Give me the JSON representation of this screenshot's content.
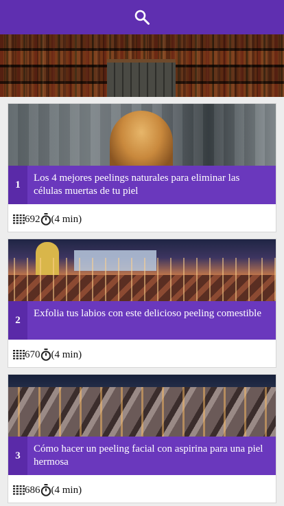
{
  "header": {
    "search_icon": "search-icon",
    "color": "#5f2fb0"
  },
  "banner": {
    "image": "bookshelf-library-photo"
  },
  "articles": [
    {
      "number": "1",
      "title": "Los 4 mejores peelings naturales para eliminar las células muertas de tu piel",
      "words": "692",
      "read_time": "(4 min)",
      "image": "woman-blonde-hair-blurred-street-photo"
    },
    {
      "number": "2",
      "title": "Exfolia tus labios con este delicioso peeling comestible",
      "words": "670",
      "read_time": "(4 min)",
      "image": "city-night-lights-photo"
    },
    {
      "number": "3",
      "title": "Cómo hacer un peeling facial con aspirina para una piel hermosa",
      "words": "686",
      "read_time": "(4 min)",
      "image": "town-rooftops-dusk-photo"
    }
  ],
  "colors": {
    "accent": "#6a38bd",
    "number_bg": "#5a2aa8"
  }
}
